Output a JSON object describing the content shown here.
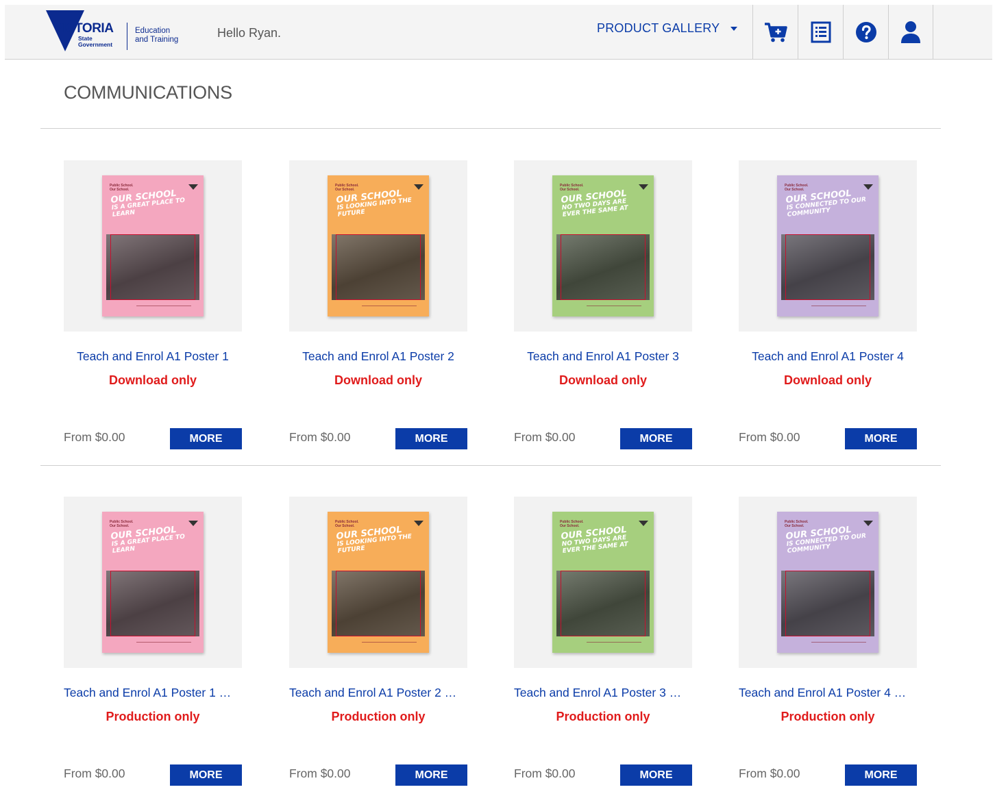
{
  "header": {
    "logo_word": "VICTORIA",
    "logo_sub": "State Government",
    "logo_dept_line1": "Education",
    "logo_dept_line2": "and Training",
    "greeting": "Hello Ryan.",
    "menu_label": "PRODUCT GALLERY",
    "icons": [
      "cart-add-icon",
      "order-list-icon",
      "help-icon",
      "user-icon"
    ]
  },
  "page": {
    "title": "COMMUNICATIONS"
  },
  "colors": {
    "brand_blue": "#0b3ca8",
    "status_red": "#e01b1b",
    "poster_pink": "#f4a7bf",
    "poster_orange": "#f7ad59",
    "poster_green": "#a6cf7e",
    "poster_purple": "#c5b1dc"
  },
  "products": [
    {
      "title": "Teach and Enrol A1 Poster 1",
      "status": "Download only",
      "price": "From $0.00",
      "button": "MORE",
      "poster": {
        "tag": "Public School. Our School.",
        "headline": "OUR SCHOOL",
        "subline": "IS A GREAT PLACE TO LEARN",
        "color": "#f4a7bf"
      }
    },
    {
      "title": "Teach and Enrol A1 Poster 2",
      "status": "Download only",
      "price": "From $0.00",
      "button": "MORE",
      "poster": {
        "tag": "Public School. Our School.",
        "headline": "OUR SCHOOL",
        "subline": "IS LOOKING INTO THE FUTURE",
        "color": "#f7ad59"
      }
    },
    {
      "title": "Teach and Enrol A1 Poster 3",
      "status": "Download only",
      "price": "From $0.00",
      "button": "MORE",
      "poster": {
        "tag": "Public School. Our School.",
        "headline": "OUR SCHOOL",
        "subline": "NO TWO DAYS ARE EVER THE SAME AT",
        "color": "#a6cf7e"
      }
    },
    {
      "title": "Teach and Enrol A1 Poster 4",
      "status": "Download only",
      "price": "From $0.00",
      "button": "MORE",
      "poster": {
        "tag": "Public School. Our School.",
        "headline": "OUR SCHOOL",
        "subline": "IS CONNECTED TO OUR COMMUNITY",
        "color": "#c5b1dc"
      }
    },
    {
      "title": "Teach and Enrol A1 Poster 1 …",
      "status": "Production only",
      "price": "From $0.00",
      "button": "MORE",
      "poster": {
        "tag": "Public School. Our School.",
        "headline": "OUR SCHOOL",
        "subline": "IS A GREAT PLACE TO LEARN",
        "color": "#f4a7bf"
      }
    },
    {
      "title": "Teach and Enrol A1 Poster 2 …",
      "status": "Production only",
      "price": "From $0.00",
      "button": "MORE",
      "poster": {
        "tag": "Public School. Our School.",
        "headline": "OUR SCHOOL",
        "subline": "IS LOOKING INTO THE FUTURE",
        "color": "#f7ad59"
      }
    },
    {
      "title": "Teach and Enrol A1 Poster 3 …",
      "status": "Production only",
      "price": "From $0.00",
      "button": "MORE",
      "poster": {
        "tag": "Public School. Our School.",
        "headline": "OUR SCHOOL",
        "subline": "NO TWO DAYS ARE EVER THE SAME AT",
        "color": "#a6cf7e"
      }
    },
    {
      "title": "Teach and Enrol A1 Poster 4 …",
      "status": "Production only",
      "price": "From $0.00",
      "button": "MORE",
      "poster": {
        "tag": "Public School. Our School.",
        "headline": "OUR SCHOOL",
        "subline": "IS CONNECTED TO OUR COMMUNITY",
        "color": "#c5b1dc"
      }
    }
  ]
}
